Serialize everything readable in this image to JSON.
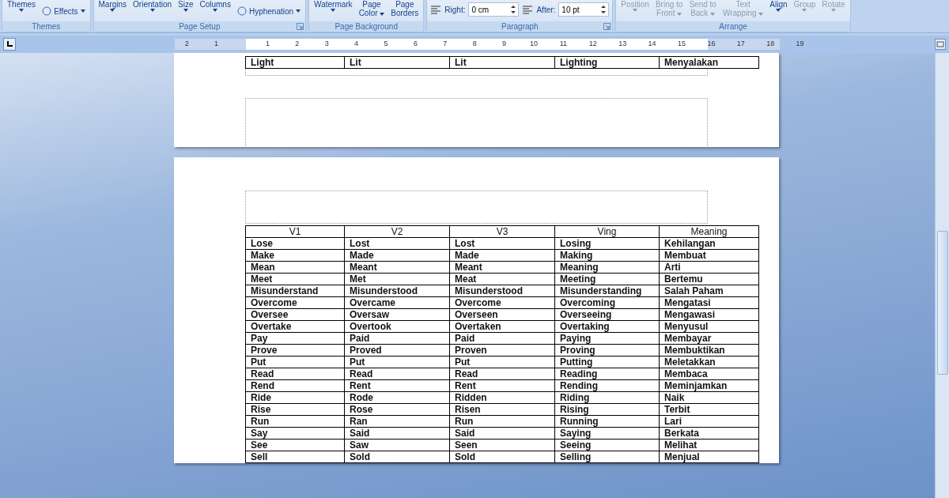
{
  "ribbon": {
    "groups": [
      {
        "label": "Themes",
        "launcher": false,
        "buttons": [
          {
            "lines": [
              "Themes"
            ],
            "caret": true,
            "disabled": false,
            "kind": "large"
          },
          {
            "lines": [
              "Effects"
            ],
            "caret": true,
            "disabled": false,
            "kind": "small"
          }
        ]
      },
      {
        "label": "Page Setup",
        "launcher": true,
        "buttons": [
          {
            "lines": [
              "Margins"
            ],
            "caret": true,
            "disabled": false,
            "kind": "large"
          },
          {
            "lines": [
              "Orientation"
            ],
            "caret": true,
            "disabled": false,
            "kind": "large"
          },
          {
            "lines": [
              "Size"
            ],
            "caret": true,
            "disabled": false,
            "kind": "large"
          },
          {
            "lines": [
              "Columns"
            ],
            "caret": true,
            "disabled": false,
            "kind": "large"
          },
          {
            "lines": [
              "Hyphenation"
            ],
            "caret": true,
            "disabled": false,
            "kind": "small"
          }
        ]
      },
      {
        "label": "Page Background",
        "launcher": false,
        "buttons": [
          {
            "lines": [
              "Watermark"
            ],
            "caret": true,
            "disabled": false,
            "kind": "large"
          },
          {
            "lines": [
              "Page",
              "Color"
            ],
            "caret": true,
            "disabled": false,
            "kind": "large"
          },
          {
            "lines": [
              "Page",
              "Borders"
            ],
            "caret": false,
            "disabled": false,
            "kind": "large"
          }
        ]
      },
      {
        "label": "Paragraph",
        "launcher": true,
        "fields": [
          {
            "label": "Right:",
            "value": "0 cm"
          },
          {
            "label": "After:",
            "value": "10 pt"
          }
        ]
      },
      {
        "label": "Arrange",
        "launcher": false,
        "buttons": [
          {
            "lines": [
              "Position"
            ],
            "caret": true,
            "disabled": true,
            "kind": "large"
          },
          {
            "lines": [
              "Bring to",
              "Front"
            ],
            "caret": true,
            "disabled": true,
            "kind": "large"
          },
          {
            "lines": [
              "Send to",
              "Back"
            ],
            "caret": true,
            "disabled": true,
            "kind": "large"
          },
          {
            "lines": [
              "Text",
              "Wrapping"
            ],
            "caret": true,
            "disabled": true,
            "kind": "large"
          },
          {
            "lines": [
              "Align"
            ],
            "caret": true,
            "disabled": false,
            "kind": "large"
          },
          {
            "lines": [
              "Group"
            ],
            "caret": true,
            "disabled": true,
            "kind": "large"
          },
          {
            "lines": [
              "Rotate"
            ],
            "caret": true,
            "disabled": true,
            "kind": "large"
          }
        ]
      }
    ]
  },
  "ruler": {
    "left_numbers": [
      "2",
      "1"
    ],
    "numbers": [
      "1",
      "2",
      "3",
      "4",
      "5",
      "6",
      "7",
      "8",
      "9",
      "10",
      "11",
      "12",
      "13",
      "14",
      "15",
      "16",
      "17",
      "18",
      "19"
    ]
  },
  "pages": [
    {
      "table": {
        "rows": [
          [
            "Light",
            "Lit",
            "Lit",
            "Lighting",
            "Menyalakan"
          ]
        ]
      }
    },
    {
      "table": {
        "header": [
          "V1",
          "V2",
          "V3",
          "Ving",
          "Meaning"
        ],
        "rows": [
          [
            "Lose",
            "Lost",
            "Lost",
            "Losing",
            "Kehilangan"
          ],
          [
            "Make",
            "Made",
            "Made",
            "Making",
            "Membuat"
          ],
          [
            "Mean",
            "Meant",
            "Meant",
            "Meaning",
            "Arti"
          ],
          [
            "Meet",
            "Met",
            "Meat",
            "Meeting",
            "Bertemu"
          ],
          [
            "Misunderstand",
            "Misunderstood",
            "Misunderstood",
            "Misunderstanding",
            "Salah Paham"
          ],
          [
            "Overcome",
            "Overcame",
            "Overcome",
            "Overcoming",
            "Mengatasi"
          ],
          [
            "Oversee",
            "Oversaw",
            "Overseen",
            "Overseeing",
            "Mengawasi"
          ],
          [
            "Overtake",
            "Overtook",
            "Overtaken",
            "Overtaking",
            "Menyusul"
          ],
          [
            "Pay",
            "Paid",
            "Paid",
            "Paying",
            "Membayar"
          ],
          [
            "Prove",
            "Proved",
            "Proven",
            "Proving",
            "Membuktikan"
          ],
          [
            "Put",
            "Put",
            "Put",
            "Putting",
            "Meletakkan"
          ],
          [
            "Read",
            "Read",
            "Read",
            "Reading",
            "Membaca"
          ],
          [
            "Rend",
            "Rent",
            "Rent",
            "Rending",
            "Meminjamkan"
          ],
          [
            "Ride",
            "Rode",
            "Ridden",
            "Riding",
            "Naik"
          ],
          [
            "Rise",
            "Rose",
            "Risen",
            "Rising",
            "Terbit"
          ],
          [
            "Run",
            "Ran",
            "Run",
            "Running",
            "Lari"
          ],
          [
            "Say",
            "Said",
            "Said",
            "Saying",
            "Berkata"
          ],
          [
            "See",
            "Saw",
            "Seen",
            "Seeing",
            "Melihat"
          ],
          [
            "Sell",
            "Sold",
            "Sold",
            "Selling",
            "Menjual"
          ]
        ]
      }
    }
  ]
}
